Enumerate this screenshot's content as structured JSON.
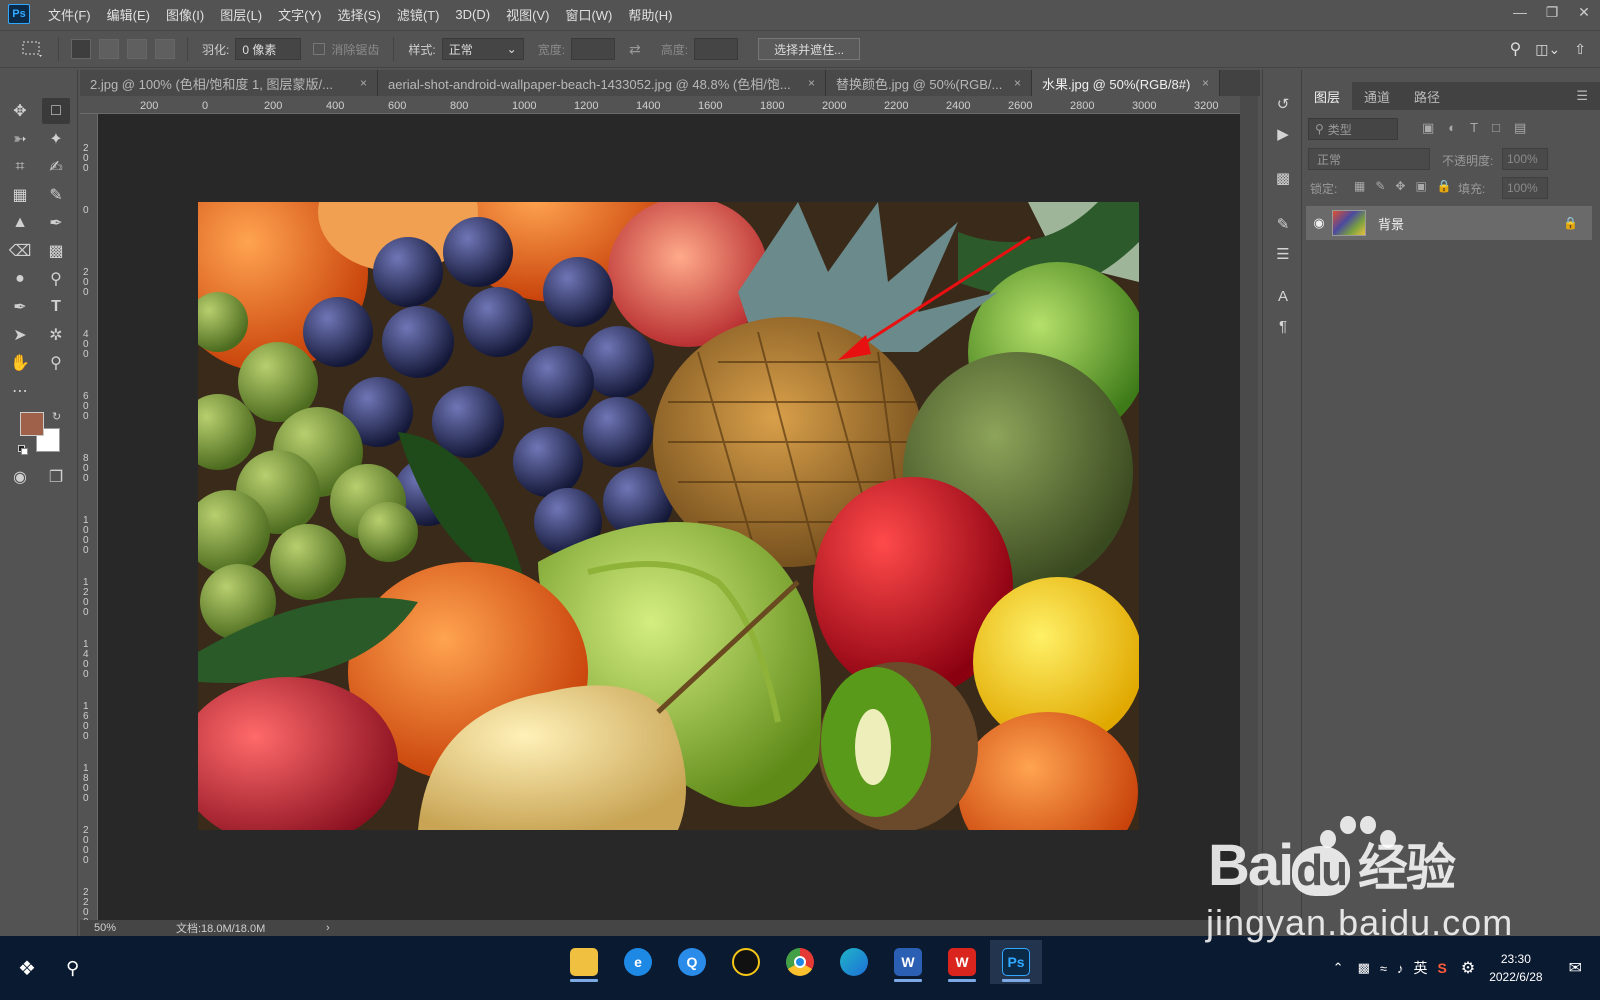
{
  "app": {
    "logo": "Ps",
    "menus": [
      "文件(F)",
      "编辑(E)",
      "图像(I)",
      "图层(L)",
      "文字(Y)",
      "选择(S)",
      "滤镜(T)",
      "3D(D)",
      "视图(V)",
      "窗口(W)",
      "帮助(H)"
    ]
  },
  "options": {
    "feather_label": "羽化:",
    "feather_value": "0 像素",
    "antialias_label": "消除锯齿",
    "style_label": "样式:",
    "style_value": "正常",
    "width_label": "宽度:",
    "height_label": "高度:",
    "select_mask_button": "选择并遮住..."
  },
  "tabs": [
    {
      "label": "2.jpg @ 100% (色相/饱和度 1, 图层蒙版/...",
      "close": "×"
    },
    {
      "label": "aerial-shot-android-wallpaper-beach-1433052.jpg  @  48.8%  (色相/饱...",
      "close": "×"
    },
    {
      "label": "替换颜色.jpg @ 50%(RGB/...",
      "close": "×"
    },
    {
      "label": "水果.jpg @ 50%(RGB/8#)",
      "close": "×"
    }
  ],
  "ruler": {
    "h_ticks": [
      "200",
      "0",
      "200",
      "400",
      "600",
      "800",
      "1000",
      "1200",
      "1400",
      "1600",
      "1800",
      "2000",
      "2200",
      "2400",
      "2600",
      "2800",
      "3000",
      "3200"
    ],
    "v_ticks": [
      "200",
      "0",
      "200",
      "400",
      "600",
      "800",
      "1000",
      "1200",
      "1400",
      "1600",
      "1800",
      "2000",
      "2200"
    ]
  },
  "status": {
    "zoom": "50%",
    "doc_info": "文档:18.0M/18.0M",
    "arrow": "›"
  },
  "layers_panel": {
    "tabs": [
      "图层",
      "通道",
      "路径"
    ],
    "filter_placeholder": "类型",
    "blend_mode": "正常",
    "opacity_label": "不透明度:",
    "opacity_value": "100%",
    "lock_label": "锁定:",
    "fill_label": "填充:",
    "fill_value": "100%",
    "layer_name": "背景"
  },
  "colors": {
    "foreground": "#a0614a",
    "background": "#ffffff",
    "accent": "#31a8ff"
  },
  "taskbar": {
    "ime": "英",
    "time": "23:30",
    "date": "2022/6/28"
  },
  "watermark": {
    "brand": "Bai",
    "brand_du": "du",
    "product": "经验",
    "url": "jingyan.baidu.com"
  }
}
